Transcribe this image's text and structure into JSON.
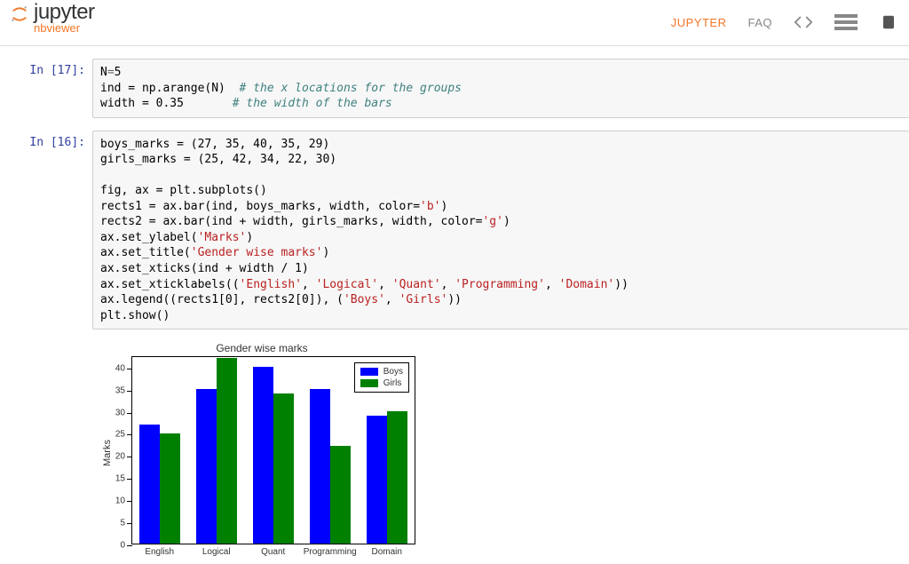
{
  "header": {
    "brand": "jupyter",
    "sub": "nbviewer",
    "nav_jupyter": "JUPYTER",
    "nav_faq": "FAQ"
  },
  "cell17": {
    "prompt": "In [17]:",
    "line1_a": "N",
    "line1_b": "=",
    "line1_c": "5",
    "line2_a": "ind = np.arange(N)  ",
    "line2_b": "# the x locations for the groups",
    "line3_a": "width = ",
    "line3_b": "0.35",
    "line3_c": "       ",
    "line3_d": "# the width of the bars"
  },
  "cell16": {
    "prompt": "In [16]:",
    "l1": "boys_marks = (27, 35, 40, 35, 29)",
    "l2": "girls_marks = (25, 42, 34, 22, 30)",
    "l3": "",
    "l4": "fig, ax = plt.subplots()",
    "l5a": "rects1 = ax.bar(ind, boys_marks, width, color=",
    "l5b": "'b'",
    "l5c": ")",
    "l6a": "rects2 = ax.bar(ind + width, girls_marks, width, color=",
    "l6b": "'g'",
    "l6c": ")",
    "l7a": "ax.set_ylabel(",
    "l7b": "'Marks'",
    "l7c": ")",
    "l8a": "ax.set_title(",
    "l8b": "'Gender wise marks'",
    "l8c": ")",
    "l9": "ax.set_xticks(ind + width / 1)",
    "l10a": "ax.set_xticklabels((",
    "l10b": "'English'",
    "l10c": ", ",
    "l10d": "'Logical'",
    "l10e": ", ",
    "l10f": "'Quant'",
    "l10g": ", ",
    "l10h": "'Programming'",
    "l10i": ", ",
    "l10j": "'Domain'",
    "l10k": "))",
    "l11a": "ax.legend((rects1[0], rects2[0]), (",
    "l11b": "'Boys'",
    "l11c": ", ",
    "l11d": "'Girls'",
    "l11e": "))",
    "l12": "plt.show()"
  },
  "chart_data": {
    "type": "bar",
    "title": "Gender wise marks",
    "ylabel": "Marks",
    "categories": [
      "English",
      "Logical",
      "Quant",
      "Programming",
      "Domain"
    ],
    "series": [
      {
        "name": "Boys",
        "values": [
          27,
          35,
          40,
          35,
          29
        ],
        "color": "#0000ff"
      },
      {
        "name": "Girls",
        "values": [
          25,
          42,
          34,
          22,
          30
        ],
        "color": "#008000"
      }
    ],
    "yticks": [
      0,
      5,
      10,
      15,
      20,
      25,
      30,
      35,
      40
    ],
    "ylim": [
      0,
      42.5
    ]
  }
}
